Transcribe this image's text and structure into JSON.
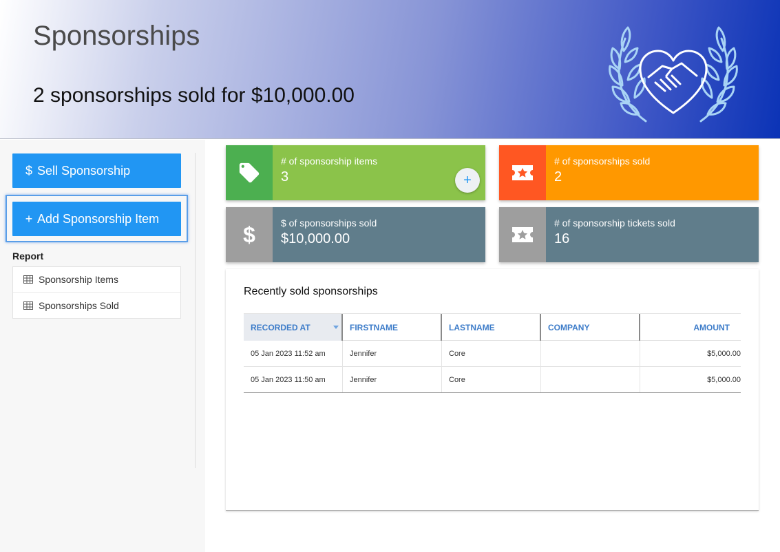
{
  "header": {
    "title": "Sponsorships",
    "summary": "2 sponsorships sold for $10,000.00",
    "logo_icon": "handshake-heart-laurel-icon"
  },
  "sidebar": {
    "sell_button": {
      "icon": "$",
      "label": "Sell Sponsorship"
    },
    "add_button": {
      "icon": "+",
      "label": "Add Sponsorship Item"
    },
    "report_heading": "Report",
    "reports": [
      {
        "icon": "grid-icon",
        "label": "Sponsorship Items"
      },
      {
        "icon": "grid-icon",
        "label": "Sponsorships Sold"
      }
    ]
  },
  "stats": [
    {
      "label": "# of sponsorship items",
      "value": "3",
      "icon": "tag-icon",
      "color": "#8bc34a",
      "add_icon": "+"
    },
    {
      "label": "# of sponsorships sold",
      "value": "2",
      "icon": "star-ticket-icon",
      "color": "#ff9800"
    },
    {
      "label": "$ of sponsorships sold",
      "value": "$10,000.00",
      "icon": "$",
      "color": "#607d8b"
    },
    {
      "label": "# of sponsorship tickets sold",
      "value": "16",
      "icon": "star-ticket-icon",
      "color": "#607d8b"
    }
  ],
  "recent": {
    "title": "Recently sold sponsorships",
    "columns": [
      "RECORDED AT",
      "FIRSTNAME",
      "LASTNAME",
      "COMPANY",
      "AMOUNT"
    ],
    "rows": [
      [
        "05 Jan 2023 11:52 am",
        "Jennifer",
        "Core",
        "",
        "$5,000.00"
      ],
      [
        "05 Jan 2023 11:50 am",
        "Jennifer",
        "Core",
        "",
        "$5,000.00"
      ]
    ]
  },
  "colors": {
    "primary": "#2196f3",
    "header_link": "#3d7cc9"
  }
}
